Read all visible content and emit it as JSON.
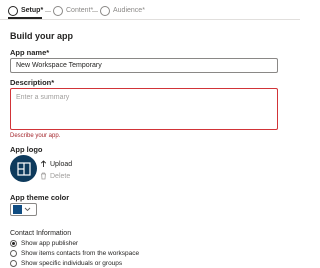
{
  "steps": [
    {
      "label": "Setup*",
      "state": "active"
    },
    {
      "label": "Content*",
      "state": "inactive"
    },
    {
      "label": "Audience*",
      "state": "inactive"
    }
  ],
  "section_title": "Build your app",
  "app_name": {
    "label": "App name*",
    "value": "New Workspace Temporary"
  },
  "description": {
    "label": "Description*",
    "placeholder": "Enter a summary",
    "error": "Describe your app."
  },
  "app_logo": {
    "label": "App logo",
    "upload_label": "Upload",
    "delete_label": "Delete"
  },
  "theme_color": {
    "label": "App theme color",
    "value": "#0f4c81"
  },
  "contact_info": {
    "title": "Contact Information",
    "options": [
      {
        "label": "Show app publisher",
        "checked": true
      },
      {
        "label": "Show items contacts from the workspace",
        "checked": false
      },
      {
        "label": "Show specific individuals or groups",
        "checked": false
      }
    ]
  },
  "icons": [
    "upload-icon",
    "delete-icon",
    "chevron-down-icon",
    "app-logo-icon"
  ]
}
